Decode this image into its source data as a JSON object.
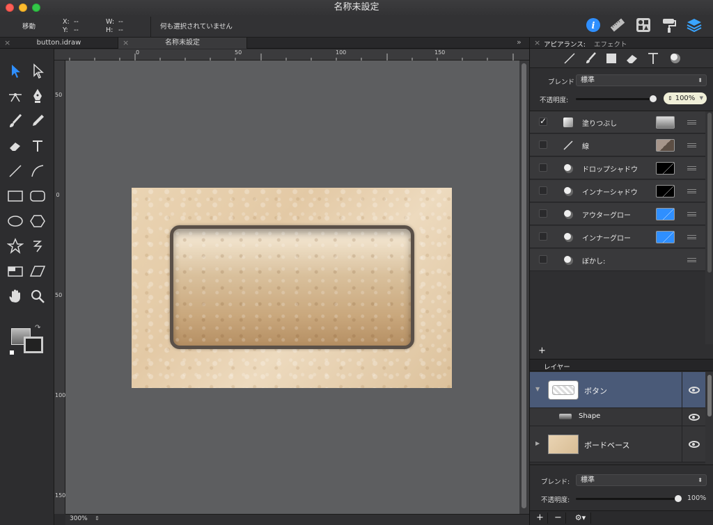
{
  "window": {
    "title": "名称未設定"
  },
  "toolbar": {
    "mode_label": "移動",
    "x_label": "X:",
    "x_value": "--",
    "y_label": "Y:",
    "y_value": "--",
    "w_label": "W:",
    "w_value": "--",
    "h_label": "H:",
    "h_value": "--",
    "selection_status": "何も選択されていません"
  },
  "tabs": [
    {
      "label": "button.idraw"
    },
    {
      "label": "名称未設定"
    }
  ],
  "tabs_overflow": "»",
  "ruler": {
    "h_labels": [
      "0",
      "50",
      "100",
      "150"
    ],
    "v_labels": [
      "50",
      "0",
      "50",
      "100",
      "150"
    ]
  },
  "canvas": {
    "zoom": "300%"
  },
  "appearance": {
    "title": "アピアランス:",
    "subtitle": "エフェクト",
    "blend_label": "ブレンド",
    "blend_value": "標準",
    "opacity_label": "不透明度:",
    "opacity_value": "100%",
    "opacity_fraction": 1.0,
    "effects": [
      {
        "name": "塗りつぶし",
        "checked": true,
        "icon": "fill-icon",
        "swatch": "#8a8a8a"
      },
      {
        "name": "線",
        "checked": false,
        "icon": "stroke-icon",
        "swatch": "#7a6a5a"
      },
      {
        "name": "ドロップシャドウ",
        "checked": false,
        "icon": "drop-shadow-icon",
        "swatch": "#000000"
      },
      {
        "name": "インナーシャドウ",
        "checked": false,
        "icon": "inner-shadow-icon",
        "swatch": "#000000"
      },
      {
        "name": "アウターグロー",
        "checked": false,
        "icon": "outer-glow-icon",
        "swatch": "#2f8fff"
      },
      {
        "name": "インナーグロー",
        "checked": false,
        "icon": "inner-glow-icon",
        "swatch": "#2f8fff"
      },
      {
        "name": "ぼかし:",
        "checked": false,
        "icon": "blur-icon",
        "swatch": ""
      }
    ],
    "add_label": "+"
  },
  "layers": {
    "title": "レイヤー",
    "items": [
      {
        "name": "ボタン",
        "selected": true
      },
      {
        "name": "Shape",
        "selected": false
      },
      {
        "name": "ボードベース",
        "selected": false
      }
    ],
    "blend_label": "ブレンド:",
    "blend_value": "標準",
    "opacity_label": "不透明度:",
    "opacity_value": "100%",
    "opacity_fraction": 1.0,
    "add_label": "+",
    "remove_label": "−",
    "gear_label": "⚙▾"
  },
  "colors": {
    "accent": "#4a5a78",
    "info": "#2f8fff"
  }
}
